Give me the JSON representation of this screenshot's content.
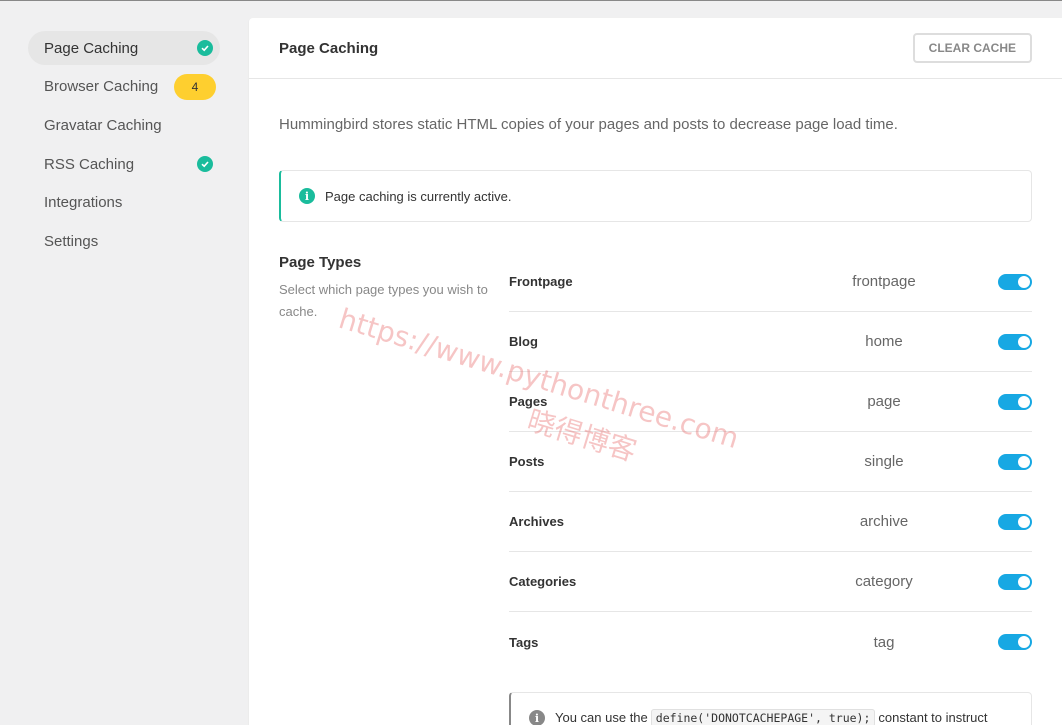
{
  "sidebar": {
    "items": [
      {
        "label": "Page Caching",
        "status": "check"
      },
      {
        "label": "Browser Caching",
        "badge": "4"
      },
      {
        "label": "Gravatar Caching"
      },
      {
        "label": "RSS Caching",
        "status": "check"
      },
      {
        "label": "Integrations"
      },
      {
        "label": "Settings"
      }
    ]
  },
  "header": {
    "title": "Page Caching",
    "clear_label": "CLEAR CACHE"
  },
  "main": {
    "description": "Hummingbird stores static HTML copies of your pages and posts to decrease page load time.",
    "notice": "Page caching is currently active.",
    "page_types_label": "Page Types",
    "page_types_desc": "Select which page types you wish to cache.",
    "types": [
      {
        "name": "Frontpage",
        "slug": "frontpage",
        "enabled": true
      },
      {
        "name": "Blog",
        "slug": "home",
        "enabled": true
      },
      {
        "name": "Pages",
        "slug": "page",
        "enabled": true
      },
      {
        "name": "Posts",
        "slug": "single",
        "enabled": true
      },
      {
        "name": "Archives",
        "slug": "archive",
        "enabled": true
      },
      {
        "name": "Categories",
        "slug": "category",
        "enabled": true
      },
      {
        "name": "Tags",
        "slug": "tag",
        "enabled": true
      }
    ],
    "bottom_notice": {
      "prefix": "You can use the",
      "code": "define('DONOTCACHEPAGE', true);",
      "suffix": "constant to instruct"
    }
  },
  "watermark": {
    "url": "https://www.pythonthree.com",
    "cn": "晓得博客"
  },
  "colors": {
    "accent_green": "#1abc9c",
    "toggle_blue": "#17a8e3",
    "badge_yellow": "#fecf2f"
  },
  "icons": [
    "check-icon",
    "info-icon"
  ]
}
